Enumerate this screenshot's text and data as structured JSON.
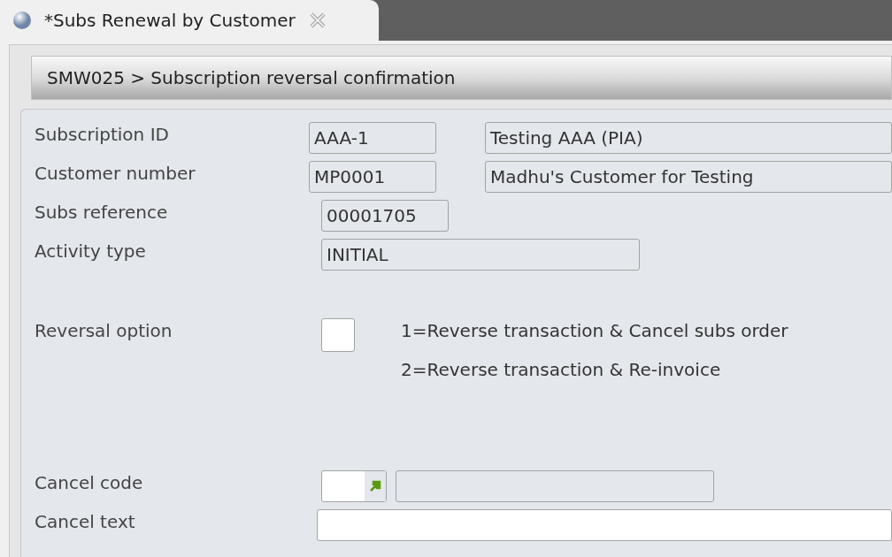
{
  "tab": {
    "title": "*Subs Renewal by Customer",
    "selected": true
  },
  "header": {
    "breadcrumb": "SMW025 > Subscription reversal confirmation"
  },
  "rows": [
    {
      "kind": "code_desc",
      "label": "Subscription ID",
      "value": "AAA-1",
      "description": "Testing AAA (PIA)"
    },
    {
      "kind": "code_desc",
      "label": "Customer number",
      "value": "MP0001",
      "description": "Madhu's Customer for Testing"
    },
    {
      "kind": "code",
      "label": "Subs reference",
      "value": "00001705"
    },
    {
      "kind": "medium",
      "label": "Activity type",
      "value": "INITIAL"
    },
    {
      "kind": "option",
      "label": "Reversal option",
      "options": [
        "1=Reverse transaction & Cancel subs order",
        "2=Reverse transaction & Re-invoice"
      ]
    },
    {
      "kind": "lookup",
      "label": "Cancel code"
    },
    {
      "kind": "wide",
      "label": "Cancel text"
    }
  ]
}
